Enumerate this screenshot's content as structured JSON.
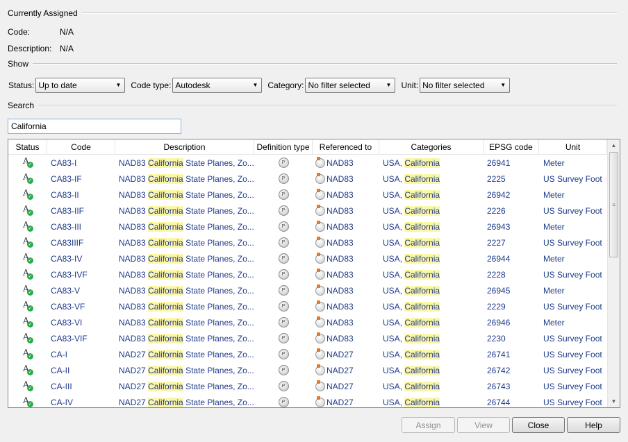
{
  "currently_assigned": {
    "heading": "Currently Assigned",
    "code_label": "Code:",
    "code_value": "N/A",
    "description_label": "Description:",
    "description_value": "N/A"
  },
  "show": {
    "heading": "Show",
    "status_label": "Status:",
    "status_value": "Up to date",
    "code_type_label": "Code type:",
    "code_type_value": "Autodesk",
    "category_label": "Category:",
    "category_value": "No filter selected",
    "unit_label": "Unit:",
    "unit_value": "No filter selected"
  },
  "search": {
    "heading": "Search",
    "value": "California"
  },
  "grid": {
    "columns": [
      "Status",
      "Code",
      "Description",
      "Definition type",
      "Referenced to",
      "Categories",
      "EPSG code",
      "Unit"
    ],
    "highlight_term": "California",
    "desc_prefix_suffix": " State Planes, Zo...",
    "cat_prefix": "USA, ",
    "def_icon_glyph": "P",
    "rows": [
      {
        "code": "CA83-I",
        "desc_prefix": "NAD83 ",
        "ref": "NAD83",
        "epsg": "26941",
        "unit": "Meter"
      },
      {
        "code": "CA83-IF",
        "desc_prefix": "NAD83 ",
        "ref": "NAD83",
        "epsg": "2225",
        "unit": "US Survey Foot"
      },
      {
        "code": "CA83-II",
        "desc_prefix": "NAD83 ",
        "ref": "NAD83",
        "epsg": "26942",
        "unit": "Meter"
      },
      {
        "code": "CA83-IIF",
        "desc_prefix": "NAD83 ",
        "ref": "NAD83",
        "epsg": "2226",
        "unit": "US Survey Foot"
      },
      {
        "code": "CA83-III",
        "desc_prefix": "NAD83 ",
        "ref": "NAD83",
        "epsg": "26943",
        "unit": "Meter"
      },
      {
        "code": "CA83IIIF",
        "desc_prefix": "NAD83 ",
        "ref": "NAD83",
        "epsg": "2227",
        "unit": "US Survey Foot"
      },
      {
        "code": "CA83-IV",
        "desc_prefix": "NAD83 ",
        "ref": "NAD83",
        "epsg": "26944",
        "unit": "Meter"
      },
      {
        "code": "CA83-IVF",
        "desc_prefix": "NAD83 ",
        "ref": "NAD83",
        "epsg": "2228",
        "unit": "US Survey Foot"
      },
      {
        "code": "CA83-V",
        "desc_prefix": "NAD83 ",
        "ref": "NAD83",
        "epsg": "26945",
        "unit": "Meter"
      },
      {
        "code": "CA83-VF",
        "desc_prefix": "NAD83 ",
        "ref": "NAD83",
        "epsg": "2229",
        "unit": "US Survey Foot"
      },
      {
        "code": "CA83-VI",
        "desc_prefix": "NAD83 ",
        "ref": "NAD83",
        "epsg": "26946",
        "unit": "Meter"
      },
      {
        "code": "CA83-VIF",
        "desc_prefix": "NAD83 ",
        "ref": "NAD83",
        "epsg": "2230",
        "unit": "US Survey Foot"
      },
      {
        "code": "CA-I",
        "desc_prefix": "NAD27 ",
        "ref": "NAD27",
        "epsg": "26741",
        "unit": "US Survey Foot"
      },
      {
        "code": "CA-II",
        "desc_prefix": "NAD27 ",
        "ref": "NAD27",
        "epsg": "26742",
        "unit": "US Survey Foot"
      },
      {
        "code": "CA-III",
        "desc_prefix": "NAD27 ",
        "ref": "NAD27",
        "epsg": "26743",
        "unit": "US Survey Foot"
      },
      {
        "code": "CA-IV",
        "desc_prefix": "NAD27 ",
        "ref": "NAD27",
        "epsg": "26744",
        "unit": "US Survey Foot"
      }
    ]
  },
  "buttons": {
    "assign": "Assign",
    "view": "View",
    "close": "Close",
    "help": "Help"
  }
}
